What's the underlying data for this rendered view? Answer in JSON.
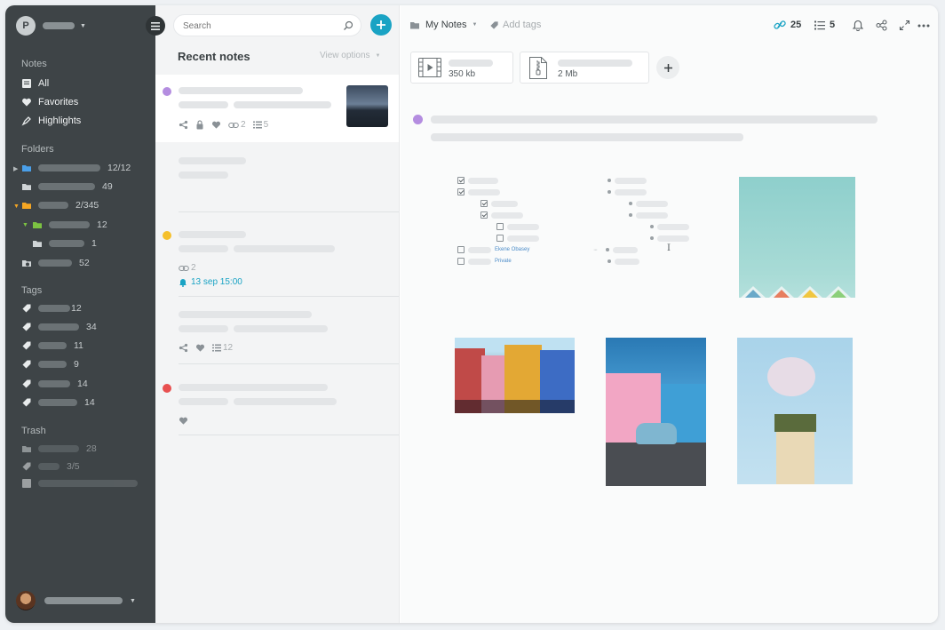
{
  "sidebar": {
    "avatar_letter": "P",
    "sections": {
      "notes": "Notes",
      "folders": "Folders",
      "tags": "Tags",
      "trash": "Trash"
    },
    "notes_items": [
      {
        "label": "All",
        "icon": "note-icon"
      },
      {
        "label": "Favorites",
        "icon": "heart-icon"
      },
      {
        "label": "Highlights",
        "icon": "highlighter-icon"
      }
    ],
    "folders": [
      {
        "count": "12/12",
        "color": "#4a9fe8"
      },
      {
        "count": "49",
        "color": "#cfd4d6"
      },
      {
        "count": "2/345",
        "color": "#f5a623"
      },
      {
        "count": "12",
        "color": "#7cc242"
      },
      {
        "count": "1",
        "color": "#cfd4d6"
      },
      {
        "count": "52",
        "color": "#cfd4d6"
      }
    ],
    "tags": [
      "12",
      "34",
      "11",
      "9",
      "14",
      "14"
    ],
    "trash": [
      "28",
      "3/5",
      ""
    ]
  },
  "list": {
    "search_placeholder": "Search",
    "title": "Recent notes",
    "view_options": "View options",
    "notes": [
      {
        "color": "#b48de0",
        "links": "2",
        "tasks": "5"
      },
      {
        "color": "",
        "links": "",
        "tasks": ""
      },
      {
        "color": "#f5c02c",
        "links": "2",
        "reminder": "13 sep 15:00"
      },
      {
        "color": "",
        "tasks": "12"
      },
      {
        "color": "#e85050"
      }
    ]
  },
  "toolbar": {
    "notebook": "My Notes",
    "add_tags": "Add tags",
    "links_count": "25",
    "tasks_count": "5"
  },
  "attachments": [
    {
      "size": "350 kb",
      "icon": "video-file-icon"
    },
    {
      "size": "2 Mb",
      "icon": "zip-file-icon"
    }
  ],
  "editor": {
    "mentions": [
      "Ekene Obasey",
      "Private"
    ]
  },
  "colors": {
    "accent": "#1aa3c4",
    "sidebar": "#3e4447"
  }
}
